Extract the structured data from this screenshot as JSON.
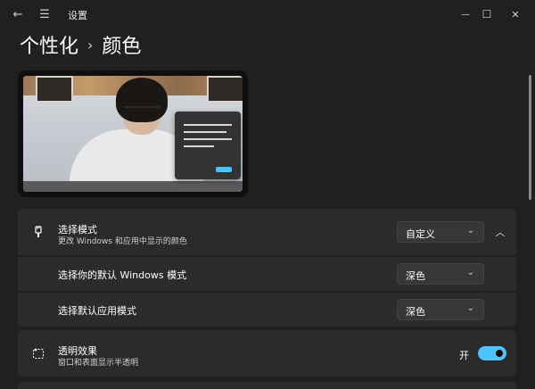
{
  "window": {
    "title": "设置",
    "back_glyph": "←",
    "menu_glyph": "☰",
    "minimize_glyph": "—",
    "maximize_glyph": "☐",
    "close_glyph": "✕"
  },
  "breadcrumb": {
    "parent": "个性化",
    "separator": "›",
    "current": "颜色"
  },
  "colors": {
    "accent": "#4cc2ff",
    "card": "#2b2b2b",
    "background": "#202020"
  },
  "choose_mode": {
    "icon": "paintbrush-icon",
    "title": "选择模式",
    "subtitle": "更改 Windows 和应用中显示的颜色",
    "dropdown_value": "自定义",
    "chevron_down": "⌄",
    "collapse_glyph": "︿"
  },
  "windows_mode": {
    "title": "选择你的默认 Windows 模式",
    "dropdown_value": "深色",
    "chevron_down": "⌄"
  },
  "app_mode": {
    "title": "选择默认应用模式",
    "dropdown_value": "深色",
    "chevron_down": "⌄"
  },
  "transparency": {
    "icon": "transparency-sparkle-icon",
    "title": "透明效果",
    "subtitle": "窗口和表面显示半透明",
    "toggle_label": "开",
    "toggle_on": true
  }
}
